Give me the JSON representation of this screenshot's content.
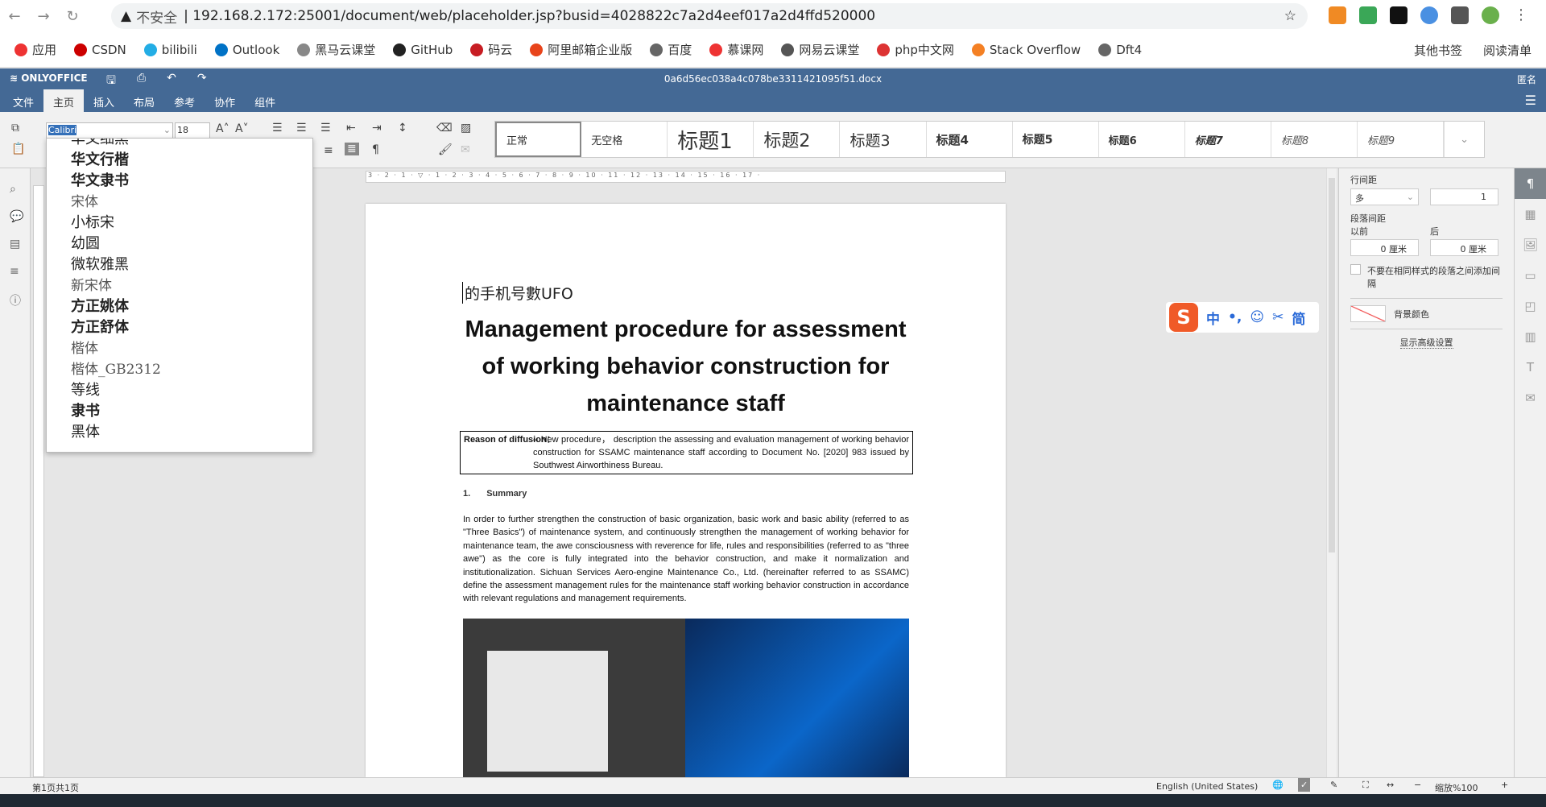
{
  "browser": {
    "security": "不安全",
    "url": "192.168.2.172:25001/document/web/placeholder.jsp?busid=4028822c7a2d4eef017a2d4ffd520000",
    "bookmarks": [
      "应用",
      "CSDN",
      "bilibili",
      "Outlook",
      "黑马云课堂",
      "GitHub",
      "码云",
      "阿里邮箱企业版",
      "百度",
      "慕课网",
      "网易云课堂",
      "php中文网",
      "Stack Overflow",
      "Dft4"
    ],
    "other_bookmarks": "其他书签",
    "reading_list": "阅读清单"
  },
  "app": {
    "logo": "ONLYOFFICE",
    "doc_title": "0a6d56ec038a4c078be3311421095f51.docx",
    "user": "匿名",
    "tabs": [
      "文件",
      "主页",
      "插入",
      "布局",
      "参考",
      "协作",
      "组件"
    ],
    "active_tab": "主页"
  },
  "toolbar": {
    "font_name": "Calibri",
    "font_size": "18",
    "styles": [
      "正常",
      "无空格",
      "标题1",
      "标题2",
      "标题3",
      "标题4",
      "标题5",
      "标题6",
      "标题7",
      "标题8",
      "标题9"
    ]
  },
  "font_dropdown": [
    "华文细黑",
    "华文行楷",
    "华文隶书",
    "宋体",
    "小标宋",
    "幼圆",
    "微软雅黑",
    "新宋体",
    "方正姚体",
    "方正舒体",
    "楷体",
    "楷体_GB2312",
    "等线",
    "隶书",
    "黑体"
  ],
  "ruler": "3 · 2 · 1 · ▽ · 1 · 2 · 3 · 4 · 5 · 6 · 7 · 8 · 9 · 10 · 11 · 12 · 13 · 14 · 15 · 16 · 17 ·",
  "document": {
    "cursor_line": "的手机号數UFO",
    "title": "Management procedure for assessment of working behavior construction for maintenance staff",
    "reason_label": "Reason of diffusion：",
    "reason_text": "– New procedure， description the assessing and evaluation management of working behavior construction for SSAMC maintenance staff according to Document No. [2020] 983 issued by Southwest  Airworthiness Bureau.",
    "section_num": "1.",
    "section_title": "Summary",
    "paragraph": "In order to further strengthen the construction of basic organization, basic work and basic ability (referred to as \"Three Basics\") of maintenance system, and continuously strengthen the management of working behavior for maintenance team, the awe consciousness with reverence for life, rules and responsibilities (referred to as \"three awe\") as the core is fully integrated into the behavior construction, and make it normalization and institutionalization.  Sichuan Services Aero-engine Maintenance Co., Ltd. (hereinafter referred to as SSAMC) define the assessment management rules for the maintenance staff working behavior construction in accordance with relevant regulations and management requirements."
  },
  "right_panel": {
    "line_spacing_label": "行间距",
    "line_spacing_mode": "多",
    "line_spacing_value": "1",
    "para_spacing_label": "段落间距",
    "before_label": "以前",
    "after_label": "后",
    "before_value": "0 厘米",
    "after_value": "0 厘米",
    "no_space_checkbox": "不要在相同样式的段落之间添加间隔",
    "bg_color_label": "背景颜色",
    "advanced_link": "显示高级设置"
  },
  "ime": {
    "items": [
      "中",
      "•,",
      "☺",
      "✂",
      "简"
    ]
  },
  "status": {
    "page": "第1页共1页",
    "language": "English (United States)",
    "zoom": "缩放%100"
  },
  "colors": {
    "header": "#446995",
    "accent": "#3470b9"
  }
}
